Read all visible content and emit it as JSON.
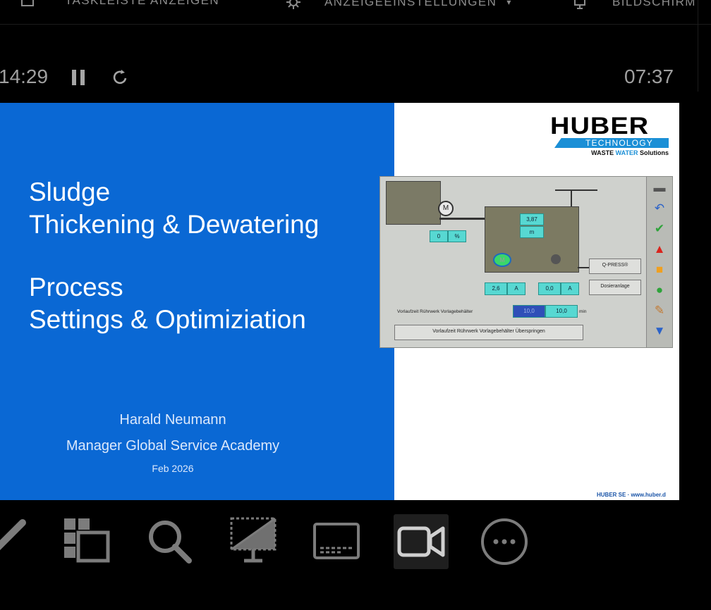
{
  "toolbar": {
    "taskbar_label": "TASKLEISTE ANZEIGEN",
    "display_settings_label": "ANZEIGEEINSTELLUNGEN",
    "screen_label": "BILDSCHIRM"
  },
  "timer": {
    "elapsed": "14:29",
    "remaining": "07:37"
  },
  "slide": {
    "title_lines": [
      "Sludge",
      "Thickening & Dewatering"
    ],
    "subtitle_lines": [
      "Process",
      "Settings & Optimiziation"
    ],
    "author": "Harald Neumann",
    "role": "Manager Global Service Academy",
    "date": "Feb 2026",
    "logo": {
      "name": "HUBER",
      "tagline": "TECHNOLOGY",
      "sub_a": "WASTE",
      "sub_b": "WATER",
      "sub_c": "Solutions"
    },
    "footer": "HUBER SE · www.huber.d",
    "hmi": {
      "level_value": "3,87",
      "level_unit": "m",
      "percent_value": "0",
      "percent_unit": "%",
      "current_1": "2,6",
      "current_1_unit": "A",
      "current_2": "0,0",
      "current_2_unit": "A",
      "btn_qpress": "Q-PRESS®",
      "btn_dosing": "Dosieranlage",
      "prerun_label": "Vorlaufzeit Rührwerk Vorlagebehälter",
      "prerun_setpoint": "10,0",
      "prerun_value": "10,0",
      "prerun_unit": "min",
      "skip_button": "Vorlaufzeit Rührwerk Vorlagebehälter Überspringen"
    }
  },
  "bottom_toolbar": {
    "buttons": [
      "pen-icon",
      "slides-overview-icon",
      "zoom-icon",
      "black-screen-icon",
      "subtitles-icon",
      "camera-icon",
      "more-options-icon"
    ],
    "active": "camera-icon"
  },
  "colors": {
    "slide_blue": "#0a68d4",
    "huber_blue": "#1b8fd6",
    "hmi_cyan": "#57d8d2"
  }
}
